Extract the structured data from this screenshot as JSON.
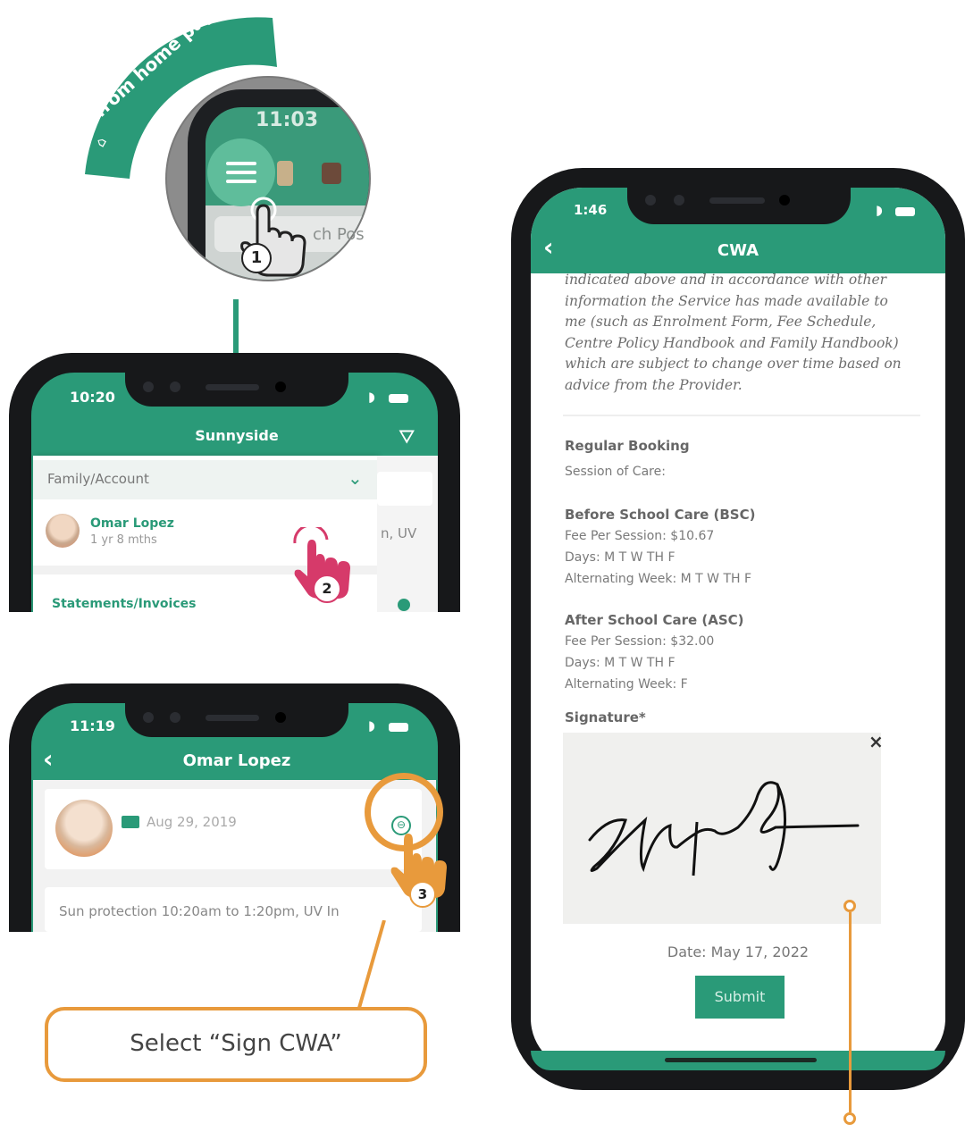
{
  "step1": {
    "arc_text": "from home page",
    "time": "11:03",
    "search_snippet": "ch Pos",
    "step_number": "1"
  },
  "phone2": {
    "time": "10:20",
    "title": "Sunnyside",
    "dropdown_label": "Family/Account",
    "child_name": "Omar Lopez",
    "child_age": "1 yr 8 mths",
    "side_snippet": "n, UV",
    "next_item": "Statements/Invoices",
    "step_number": "2"
  },
  "phone3": {
    "time": "11:19",
    "title": "Omar Lopez",
    "date": "Aug 29, 2019",
    "notice": "Sun protection 10:20am to 1:20pm, UV In",
    "step_number": "3"
  },
  "callout": {
    "text": "Select “Sign CWA”"
  },
  "phone4": {
    "time": "1:46",
    "title": "CWA",
    "paragraph": [
      "indicated above and in accordance with other",
      "information the Service has made available to",
      "me (such as Enrolment Form, Fee Schedule,",
      "Centre Policy Handbook and Family Handbook)",
      "which are subject to change over time based on",
      "advice from the Provider."
    ],
    "regular_booking": "Regular Booking",
    "session_of_care": "Session of Care:",
    "bsc": {
      "heading": "Before School Care (BSC)",
      "fee": "Fee Per Session: $10.67",
      "days": "Days: M T W TH F",
      "alt": "Alternating Week: M T W TH F"
    },
    "asc": {
      "heading": "After School Care (ASC)",
      "fee": "Fee Per Session: $32.00",
      "days": "Days: M T W TH F",
      "alt": "Alternating Week: F"
    },
    "signature_label": "Signature*",
    "clear_icon": "×",
    "date": "Date: May 17, 2022",
    "submit": "Submit"
  },
  "colors": {
    "teal": "#2a9a78",
    "orange": "#e89a3c",
    "pink": "#d63a6a"
  }
}
